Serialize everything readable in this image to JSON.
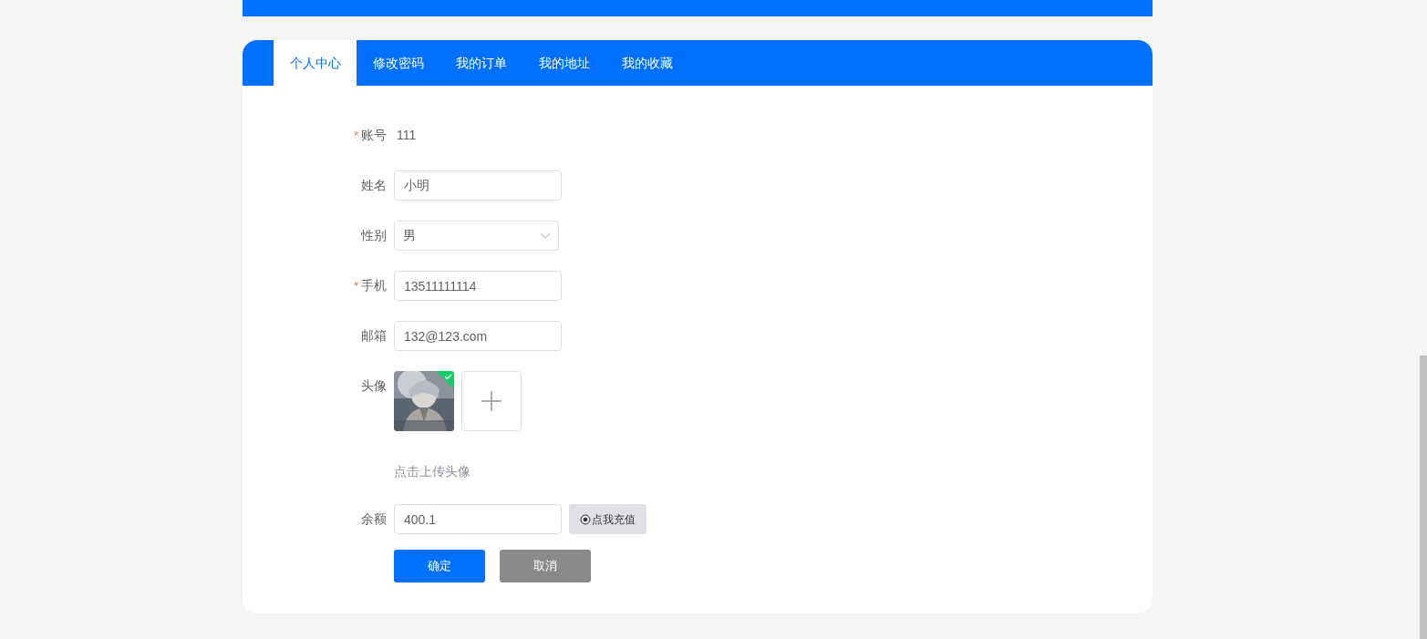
{
  "tabs": [
    {
      "label": "个人中心",
      "selected": true
    },
    {
      "label": "修改密码",
      "selected": false
    },
    {
      "label": "我的订单",
      "selected": false
    },
    {
      "label": "我的地址",
      "selected": false
    },
    {
      "label": "我的收藏",
      "selected": false
    }
  ],
  "form": {
    "fields": [
      {
        "kind": "text",
        "required_mark": "*",
        "label": "账号",
        "value": "111"
      },
      {
        "kind": "input",
        "label": "姓名",
        "value": "小明"
      },
      {
        "kind": "select",
        "label": "性别",
        "value": "男"
      },
      {
        "kind": "input",
        "required_mark": "*",
        "label": "手机",
        "value": "13511111114"
      },
      {
        "kind": "input",
        "label": "邮箱",
        "value": "132@123.com"
      },
      {
        "kind": "upload",
        "label": "头像",
        "hint": "点击上传头像"
      },
      {
        "kind": "balance",
        "label": "余额",
        "value": "400.1",
        "button": "点我充值"
      }
    ],
    "buttons": [
      {
        "label": "确定",
        "kind": "primary"
      },
      {
        "label": "取消",
        "kind": "secondary"
      }
    ]
  }
}
